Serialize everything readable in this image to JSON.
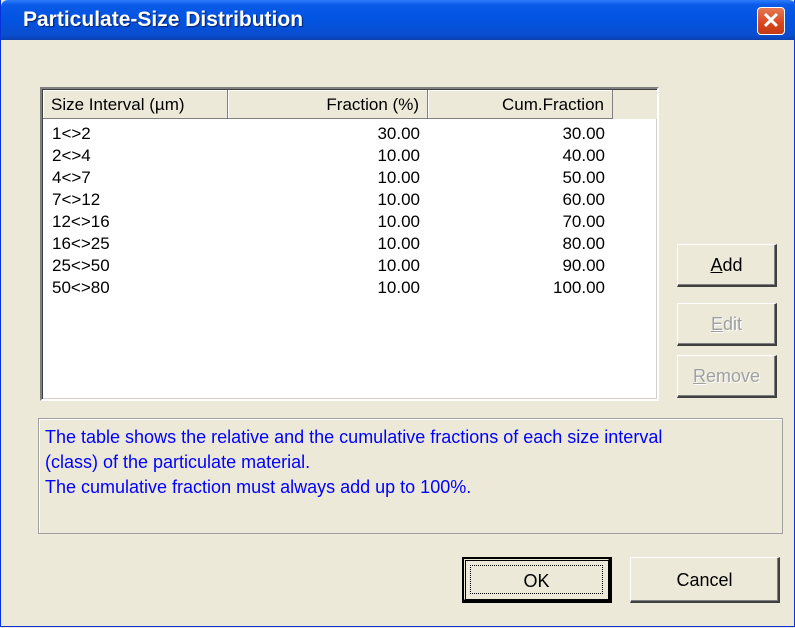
{
  "window": {
    "title": "Particulate-Size Distribution",
    "close_glyph": "✕"
  },
  "table": {
    "columns": [
      "Size Interval (µm)",
      "Fraction (%)",
      "Cum.Fraction"
    ],
    "rows": [
      [
        "1<>2",
        "30.00",
        "30.00"
      ],
      [
        "2<>4",
        "10.00",
        "40.00"
      ],
      [
        "4<>7",
        "10.00",
        "50.00"
      ],
      [
        "7<>12",
        "10.00",
        "60.00"
      ],
      [
        "12<>16",
        "10.00",
        "70.00"
      ],
      [
        "16<>25",
        "10.00",
        "80.00"
      ],
      [
        "25<>50",
        "10.00",
        "90.00"
      ],
      [
        "50<>80",
        "10.00",
        "100.00"
      ]
    ]
  },
  "buttons": {
    "add": {
      "mnemonic": "A",
      "rest": "dd",
      "enabled": true
    },
    "edit": {
      "mnemonic": "E",
      "rest": "dit",
      "enabled": false
    },
    "remove": {
      "mnemonic": "R",
      "rest": "emove",
      "enabled": false
    },
    "ok": "OK",
    "cancel": "Cancel"
  },
  "info": {
    "lines": [
      "The table shows the relative and the cumulative fractions of each size interval",
      "(class) of the particulate material.",
      "The cumulative fraction must always add up to 100%."
    ],
    "color": "#0000ff"
  },
  "colors": {
    "titlebar": "#0253e2",
    "dialog_bg": "#ece9d8",
    "close": "#d9451d"
  }
}
